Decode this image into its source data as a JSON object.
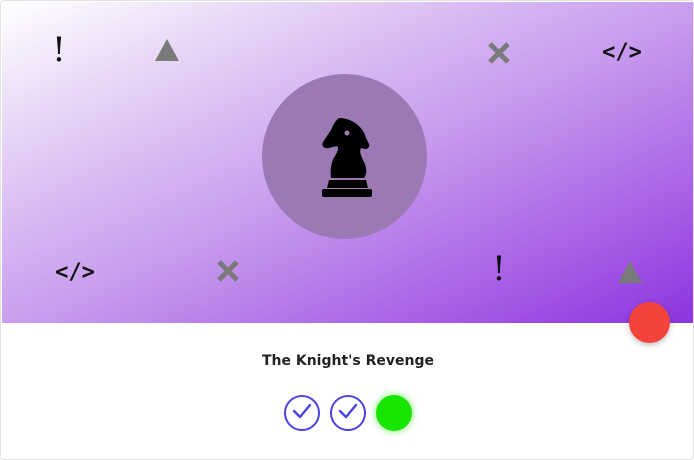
{
  "card": {
    "title": "The Knight's Revenge"
  },
  "hero": {
    "gradient_colors": [
      "#ffffff",
      "#c79bee",
      "#8b34df"
    ],
    "medallion_color": "#9b79b5",
    "medallion_icon": "chess-knight-icon",
    "decorations": [
      {
        "icon": "exclamation-icon",
        "glyph": "!"
      },
      {
        "icon": "triangle-icon"
      },
      {
        "icon": "x-mark-icon"
      },
      {
        "icon": "code-icon",
        "glyph": "</>"
      },
      {
        "icon": "code-icon",
        "glyph": "</>"
      },
      {
        "icon": "x-mark-icon"
      },
      {
        "icon": "exclamation-icon",
        "glyph": "!"
      },
      {
        "icon": "triangle-icon"
      }
    ]
  },
  "status": {
    "dot_color": "#f4433c"
  },
  "progress": {
    "steps": [
      {
        "state": "completed",
        "icon": "checkmark-icon"
      },
      {
        "state": "completed",
        "icon": "checkmark-icon"
      },
      {
        "state": "current",
        "color": "#19e600"
      }
    ]
  }
}
